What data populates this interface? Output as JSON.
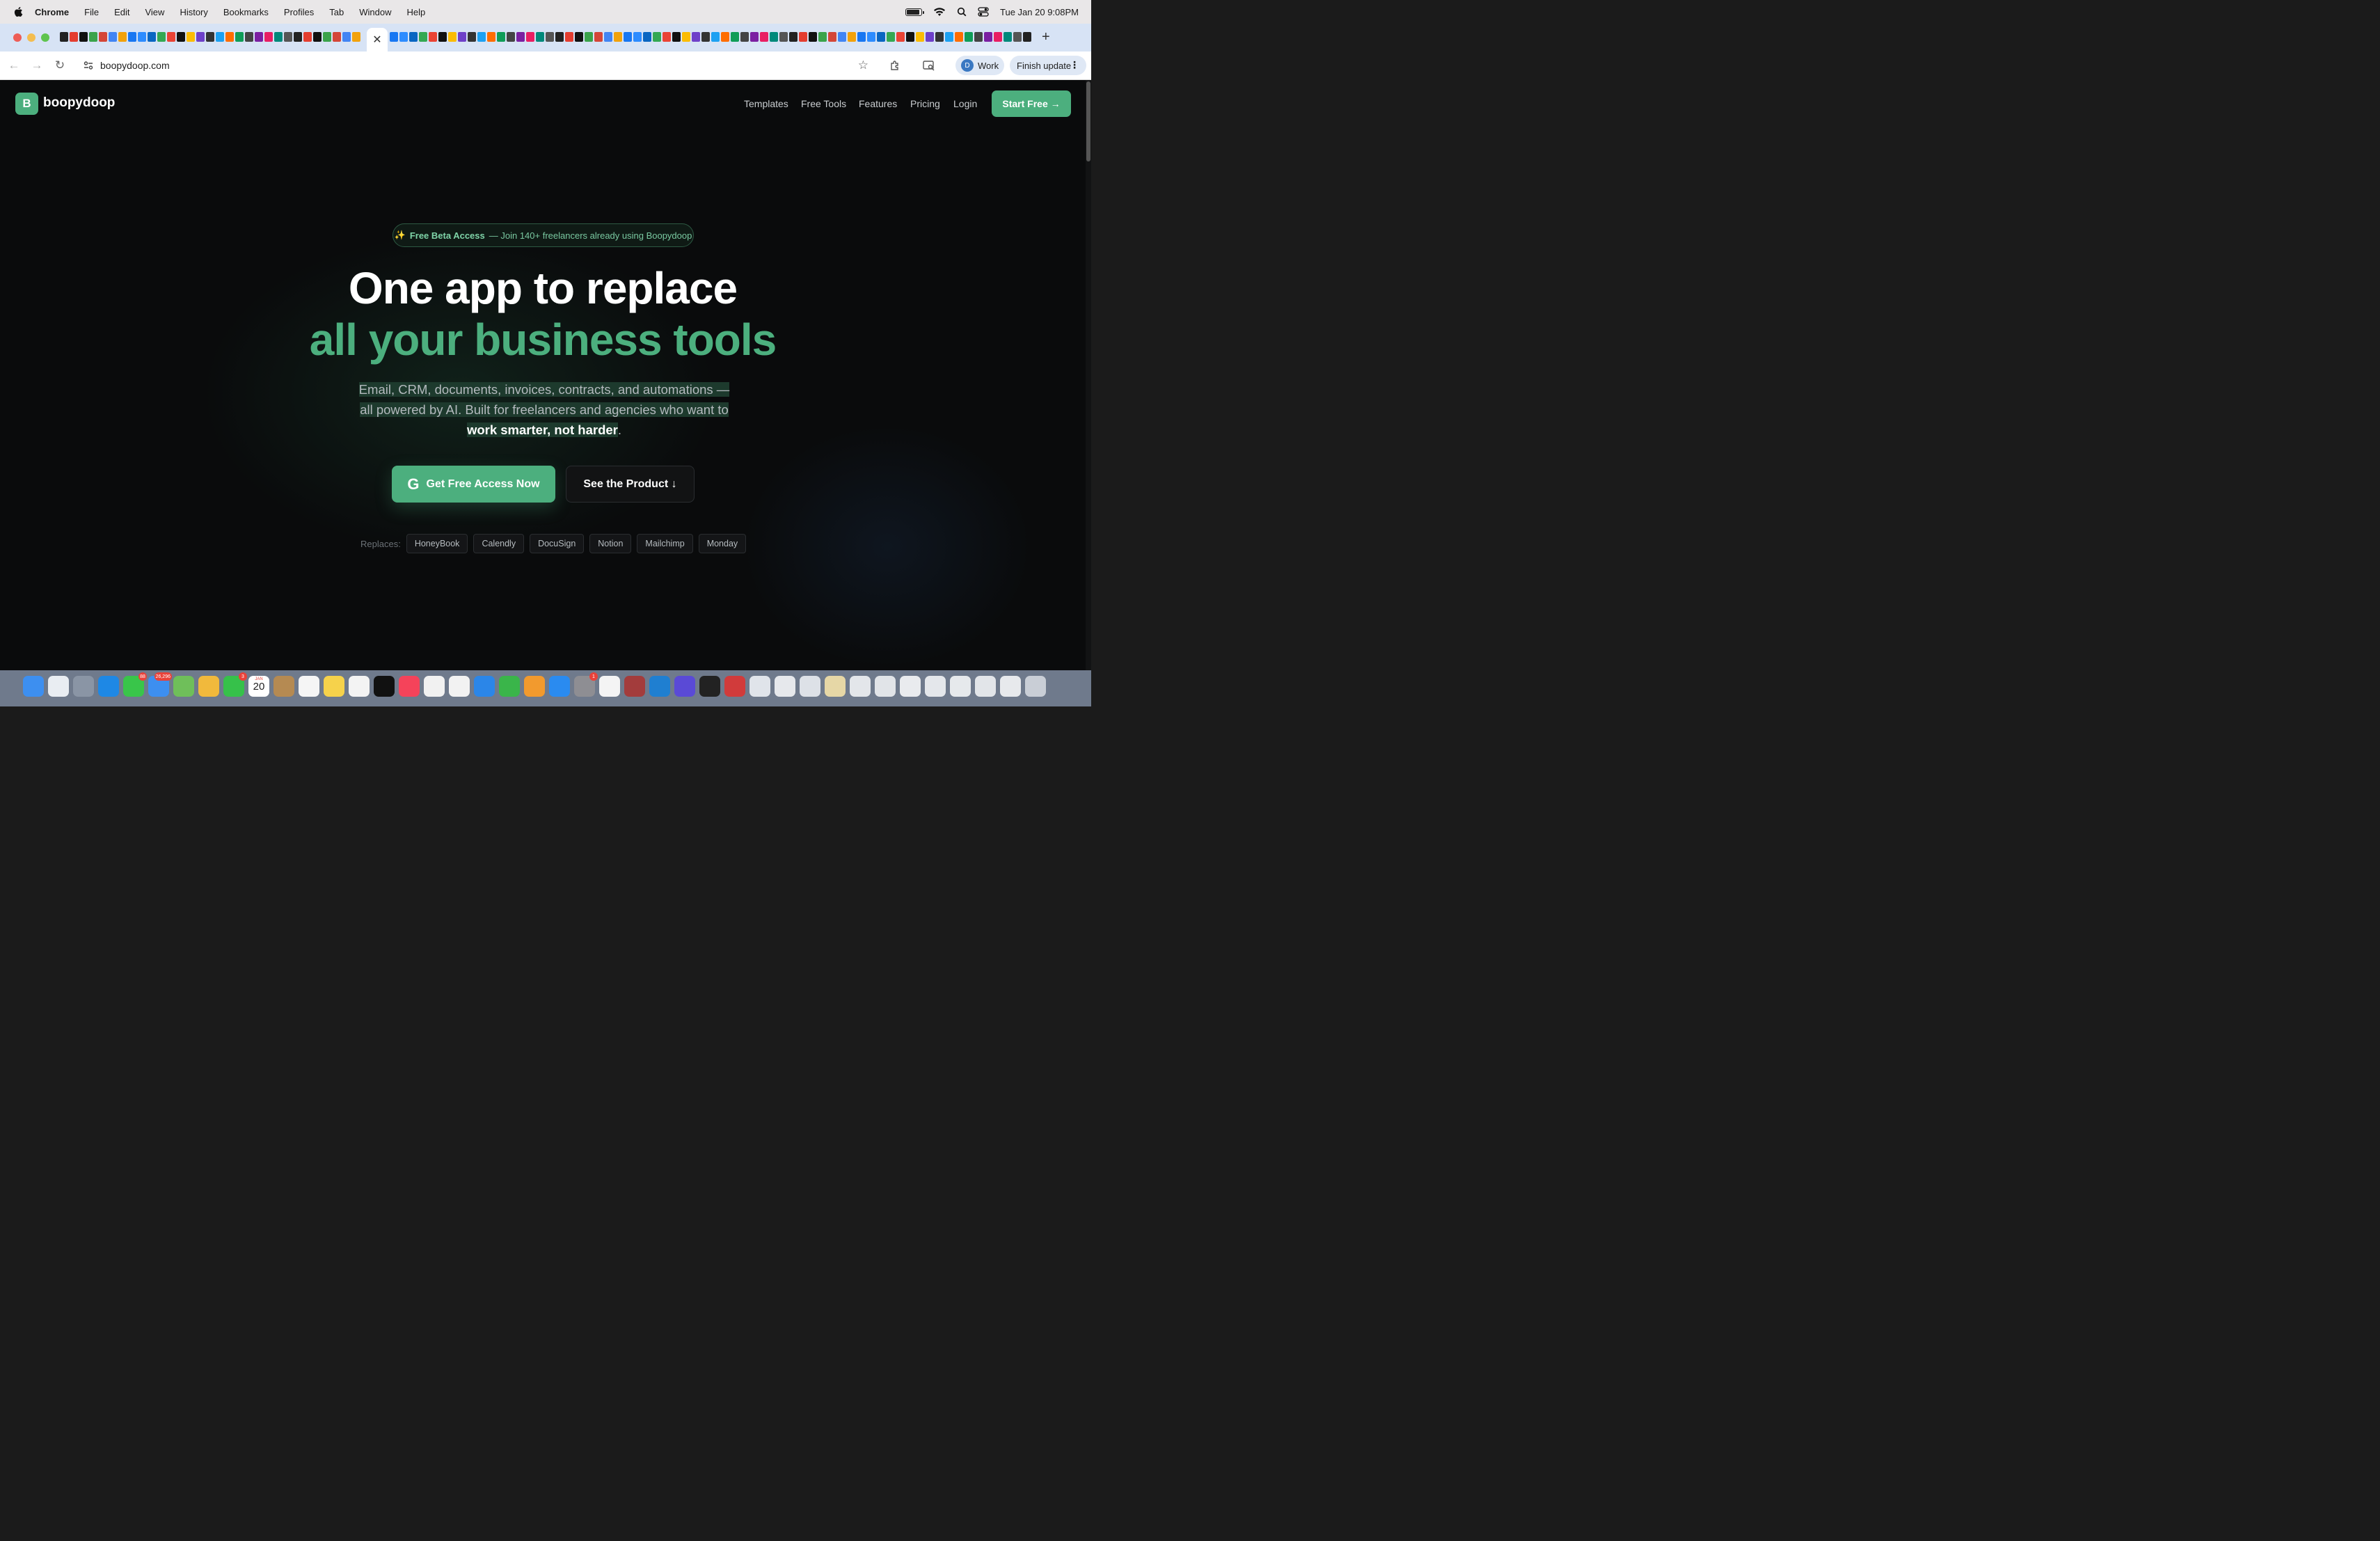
{
  "menubar": {
    "app": "Chrome",
    "items": [
      "File",
      "Edit",
      "View",
      "History",
      "Bookmarks",
      "Profiles",
      "Tab",
      "Window",
      "Help"
    ],
    "datetime": "Tue Jan 20  9:08PM",
    "battery_level": 0.9
  },
  "tabstrip": {
    "close_glyph": "✕",
    "new_tab_glyph": "+"
  },
  "toolbar": {
    "url": "boopydoop.com",
    "profile_initial": "D",
    "profile_label": "Work",
    "update_label": "Finish update",
    "back_glyph": "←",
    "forward_glyph": "→",
    "reload_glyph": "↻",
    "star_glyph": "☆"
  },
  "site": {
    "logo_letter": "B",
    "logo_name": "boopydoop",
    "nav": [
      "Templates",
      "Free Tools",
      "Features",
      "Pricing",
      "Login"
    ],
    "start_button": "Start Free →",
    "badge_sparkle": "✨",
    "badge_bold": "Free Beta Access",
    "badge_rest": "— Join 140+ freelancers already using Boopydoop",
    "headline_1": "One app to replace",
    "headline_2": "all your business tools",
    "sub_1": "Email, CRM, documents, invoices, contracts, and automations — all powered by AI. Built for freelancers and agencies who want to ",
    "sub_bold": "work smarter, not harder",
    "sub_end": ".",
    "cta_primary_icon": "G",
    "cta_primary": "Get Free Access Now",
    "cta_secondary": "See the Product ↓",
    "replaces_label": "Replaces:",
    "replaces": [
      "HoneyBook",
      "Calendly",
      "DocuSign",
      "Notion",
      "Mailchimp",
      "Monday"
    ]
  },
  "dock": {
    "badges": {
      "messages": "88",
      "mail": "26,296",
      "facetime": "3",
      "settings": "1"
    },
    "calendar_month": "JAN",
    "calendar_day": "20"
  },
  "colors": {
    "accent": "#4caf7e",
    "page_bg": "#0a0b0c",
    "tabstrip_bg": "#d7e3f5"
  }
}
